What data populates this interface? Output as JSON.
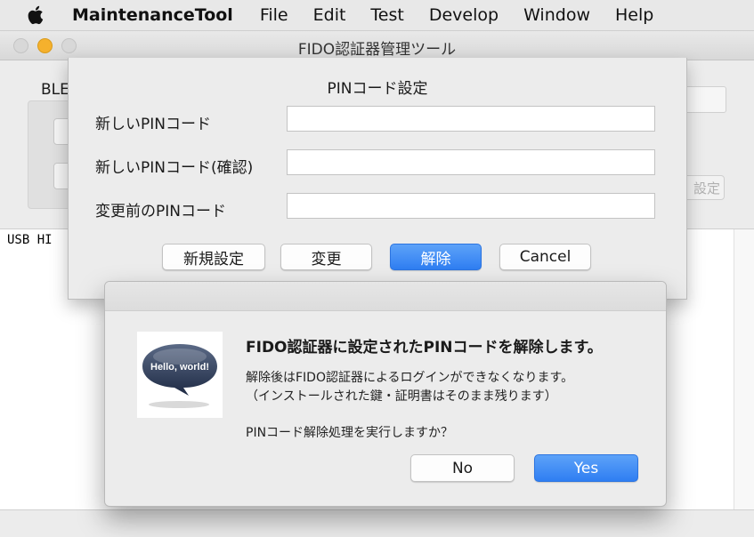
{
  "menubar": {
    "apple_icon": "apple-icon",
    "app_name": "MaintenanceTool",
    "items": [
      "File",
      "Edit",
      "Test",
      "Develop",
      "Window",
      "Help"
    ]
  },
  "window": {
    "title": "FIDO認証器管理ツール",
    "ble_label": "BLE",
    "set_button_partial": "設定",
    "log_text": "USB HI"
  },
  "pin_sheet": {
    "title": "PINコード設定",
    "fields": [
      {
        "label": "新しいPINコード",
        "value": ""
      },
      {
        "label": "新しいPINコード(確認)",
        "value": ""
      },
      {
        "label": "変更前のPINコード",
        "value": ""
      }
    ],
    "buttons": {
      "new": "新規設定",
      "change": "変更",
      "clear": "解除",
      "cancel": "Cancel"
    }
  },
  "alert": {
    "icon_text": "Hello, world!",
    "heading": "FIDO認証器に設定されたPINコードを解除します。",
    "body_line1": "解除後はFIDO認証器によるログインができなくなります。",
    "body_line2": "（インストールされた鍵・証明書はそのまま残ります）",
    "question": "PINコード解除処理を実行しますか？",
    "no_label": "No",
    "yes_label": "Yes"
  },
  "colors": {
    "accent": "#2f7ef2",
    "minimize_light": "#f5b12d"
  }
}
